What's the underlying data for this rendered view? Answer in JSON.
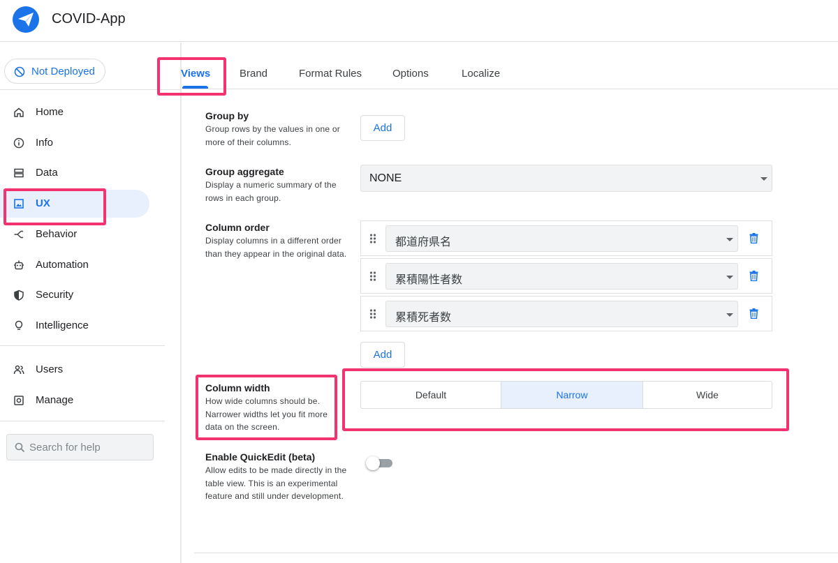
{
  "app": {
    "title": "COVID-App"
  },
  "sidebar": {
    "deploy_status": "Not Deployed",
    "items": [
      {
        "label": "Home",
        "icon": "home-icon"
      },
      {
        "label": "Info",
        "icon": "info-icon"
      },
      {
        "label": "Data",
        "icon": "data-icon"
      },
      {
        "label": "UX",
        "icon": "image-icon",
        "active": true
      },
      {
        "label": "Behavior",
        "icon": "behavior-icon"
      },
      {
        "label": "Automation",
        "icon": "robot-icon"
      },
      {
        "label": "Security",
        "icon": "shield-icon"
      },
      {
        "label": "Intelligence",
        "icon": "lightbulb-icon"
      }
    ],
    "secondary_items": [
      {
        "label": "Users",
        "icon": "users-icon"
      },
      {
        "label": "Manage",
        "icon": "gear-icon"
      }
    ],
    "search_placeholder": "Search for help"
  },
  "tabs": [
    {
      "label": "Views",
      "active": true
    },
    {
      "label": "Brand"
    },
    {
      "label": "Format Rules"
    },
    {
      "label": "Options"
    },
    {
      "label": "Localize"
    }
  ],
  "settings": {
    "group_by": {
      "title": "Group by",
      "description": "Group rows by the values in one or more of their columns.",
      "add_label": "Add"
    },
    "group_aggregate": {
      "title": "Group aggregate",
      "description": "Display a numeric summary of the rows in each group.",
      "value": "NONE"
    },
    "column_order": {
      "title": "Column order",
      "description": "Display columns in a different order than they appear in the original data.",
      "columns": [
        "都道府県名",
        "累積陽性者数",
        "累積死者数"
      ],
      "add_label": "Add"
    },
    "column_width": {
      "title": "Column width",
      "description": "How wide columns should be. Narrower widths let you fit more data on the screen.",
      "options": [
        "Default",
        "Narrow",
        "Wide"
      ],
      "selected": "Narrow"
    },
    "quick_edit": {
      "title": "Enable QuickEdit (beta)",
      "description": "Allow edits to be made directly in the table view. This is an experimental feature and still under development.",
      "enabled": false
    }
  },
  "colors": {
    "accent": "#1a73e8",
    "highlight": "#f2336f",
    "active_bg": "#e8f0fe"
  }
}
